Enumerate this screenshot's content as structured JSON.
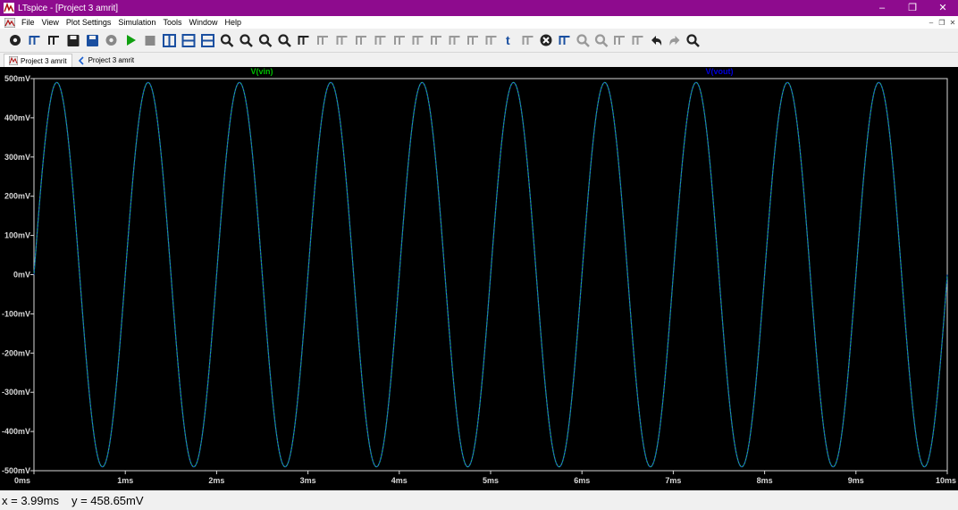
{
  "window": {
    "title": "LTspice - [Project 3 amrit]"
  },
  "menu": [
    "File",
    "View",
    "Plot Settings",
    "Simulation",
    "Tools",
    "Window",
    "Help"
  ],
  "toolbar": {
    "tools": [
      "settings-gear",
      "open-schematic",
      "open-folder",
      "save",
      "print",
      "halt",
      "run",
      "stop",
      "tile-vertical",
      "tile-horizontal",
      "cascade",
      "zoom-in",
      "zoom-out",
      "zoom-full",
      "zoom-fit",
      "autorange",
      "wire",
      "ground",
      "label-net",
      "resistor",
      "capacitor",
      "inductor",
      "diode",
      "component",
      "move",
      "drag",
      "undo-text",
      "spice-directive",
      "delete",
      "duplicate",
      "zoom-area",
      "zoom-back",
      "mirror",
      "rotate",
      "undo",
      "redo",
      "find"
    ]
  },
  "tabs": [
    {
      "label": "Project 3 amrit",
      "icon": "schematic-icon"
    },
    {
      "label": "Project 3 amrit",
      "icon": "waveform-icon"
    }
  ],
  "plot": {
    "trace_labels": [
      {
        "name": "V(vin)",
        "color": "#00c000"
      },
      {
        "name": "V(vout)",
        "color": "#0000e0"
      }
    ],
    "colors": {
      "background": "#000000",
      "axis": "#d8d8d8",
      "label": "#d8d8d8",
      "grid": "#2a2a2a",
      "vin": "#1fae8a",
      "vout": "#1c3ad8"
    }
  },
  "status": {
    "x": "x = 3.99ms",
    "y": "y = 458.65mV"
  },
  "chart_data": {
    "type": "line",
    "xlabel": "",
    "ylabel": "",
    "x_ticks": [
      "0ms",
      "1ms",
      "2ms",
      "3ms",
      "4ms",
      "5ms",
      "6ms",
      "7ms",
      "8ms",
      "9ms",
      "10ms"
    ],
    "y_ticks": [
      "500mV",
      "400mV",
      "300mV",
      "200mV",
      "100mV",
      "0mV",
      "-100mV",
      "-200mV",
      "-300mV",
      "-400mV",
      "-500mV"
    ],
    "xlim_ms": [
      0,
      10
    ],
    "ylim_mv": [
      -500,
      500
    ],
    "series": [
      {
        "name": "V(vin)",
        "waveform": "sine",
        "amplitude_mv": 490,
        "frequency_hz": 1000,
        "offset_mv": 0
      },
      {
        "name": "V(vout)",
        "waveform": "sine",
        "amplitude_mv": 490,
        "frequency_hz": 1000,
        "offset_mv": 0
      }
    ]
  }
}
